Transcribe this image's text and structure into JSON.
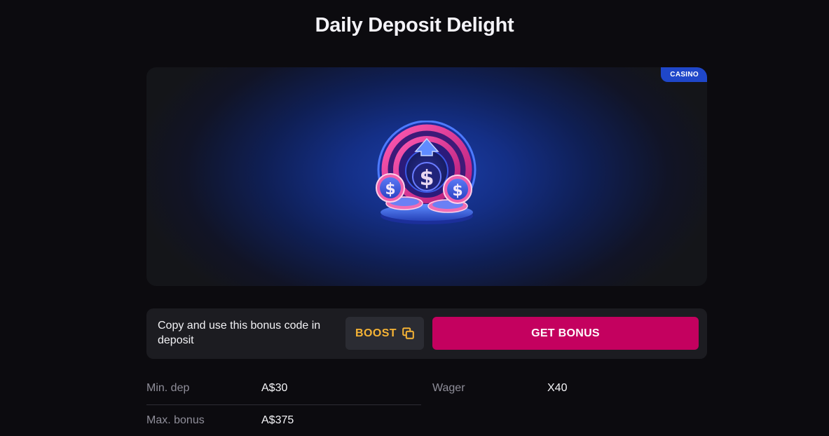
{
  "page": {
    "title": "Daily Deposit Delight"
  },
  "hero": {
    "badge": "CASINO",
    "image": "coins-with-dollar-signs-and-up-arrow-illustration",
    "accent_colors": {
      "pink": "#e0358f",
      "blue": "#3a6cf2"
    }
  },
  "code_bar": {
    "instruction": "Copy and use this bonus code in deposit",
    "code": "BOOST",
    "copy_icon": "copy-icon",
    "cta_label": "GET BONUS"
  },
  "stats": {
    "min_dep_label": "Min. dep",
    "min_dep_value": "A$30",
    "wager_label": "Wager",
    "wager_value": "X40",
    "max_bonus_label": "Max. bonus",
    "max_bonus_value": "A$375"
  },
  "colors": {
    "background": "#0c0b0f",
    "cta": "#c4015f",
    "code_text": "#f5b335",
    "badge": "#1f47c9"
  }
}
